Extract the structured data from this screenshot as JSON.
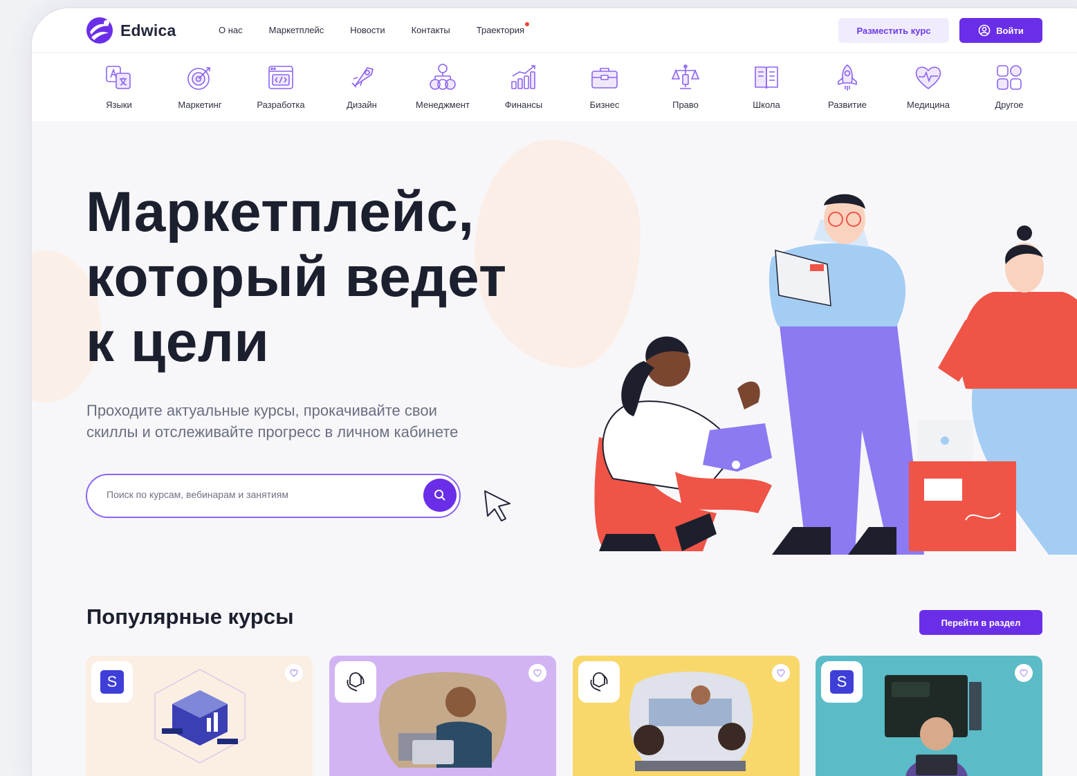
{
  "brand": {
    "name": "Edwica",
    "accent": "#6a2ee8"
  },
  "nav": {
    "items": [
      {
        "label": "О нас"
      },
      {
        "label": "Маркетплейс"
      },
      {
        "label": "Новости"
      },
      {
        "label": "Контакты"
      },
      {
        "label": "Траектория"
      }
    ],
    "place_course": "Разместить курс",
    "login": "Войти"
  },
  "categories": [
    {
      "label": "Языки",
      "icon": "languages-icon"
    },
    {
      "label": "Маркетинг",
      "icon": "target-icon"
    },
    {
      "label": "Разработка",
      "icon": "code-window-icon"
    },
    {
      "label": "Дизайн",
      "icon": "rocket-pen-icon"
    },
    {
      "label": "Менеджмент",
      "icon": "team-icon"
    },
    {
      "label": "Финансы",
      "icon": "growth-chart-icon"
    },
    {
      "label": "Бизнес",
      "icon": "briefcase-icon"
    },
    {
      "label": "Право",
      "icon": "scales-icon"
    },
    {
      "label": "Школа",
      "icon": "book-icon"
    },
    {
      "label": "Развитие",
      "icon": "rocket-icon"
    },
    {
      "label": "Медицина",
      "icon": "heart-pulse-icon"
    },
    {
      "label": "Другое",
      "icon": "grid-icon"
    }
  ],
  "hero": {
    "title_lines": [
      "Маркетплейс,",
      "который ведет",
      "к цели"
    ],
    "subtitle_lines": [
      "Проходите актуальные курсы, прокачивайте свои",
      "скиллы и отслеживайте прогресс в личном кабинете"
    ],
    "search_placeholder": "Поиск по курсам, вебинарам и занятиям"
  },
  "popular": {
    "title": "Популярные курсы",
    "go_section": "Перейти в раздел",
    "cards": [
      {
        "provider_badge": "S",
        "bg": "#fbeee2"
      },
      {
        "provider_badge": "openai-logo-icon",
        "bg": "#d2b4f3"
      },
      {
        "provider_badge": "openai-logo-icon",
        "bg": "#f8d86b"
      },
      {
        "provider_badge": "S",
        "bg": "#5bbcc8"
      }
    ]
  }
}
